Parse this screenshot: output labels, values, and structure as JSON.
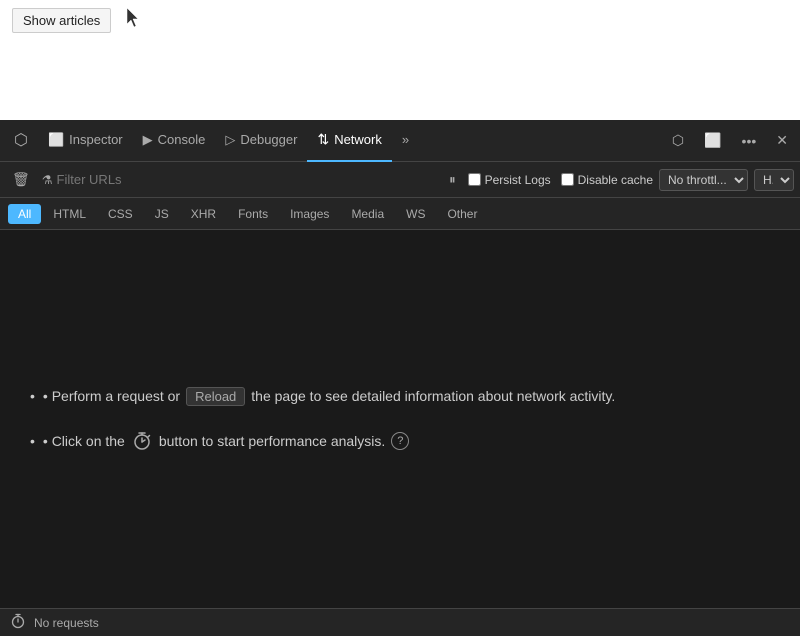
{
  "browser": {
    "show_articles_label": "Show articles"
  },
  "devtools": {
    "tabs": [
      {
        "id": "inspect",
        "label": "",
        "icon": "⬜",
        "active": false
      },
      {
        "id": "inspector",
        "label": "Inspector",
        "icon": "🔲",
        "active": false
      },
      {
        "id": "console",
        "label": "Console",
        "icon": "▶",
        "active": false
      },
      {
        "id": "debugger",
        "label": "Debugger",
        "icon": "▷",
        "active": false
      },
      {
        "id": "network",
        "label": "Network",
        "icon": "⇅",
        "active": true
      },
      {
        "id": "more",
        "label": "",
        "icon": "»",
        "active": false
      }
    ],
    "toolbar_right": {
      "screenshot_icon": "📷",
      "responsive_icon": "📱",
      "more_icon": "•••",
      "close_icon": "✕"
    },
    "filter": {
      "clear_label": "🗑",
      "placeholder": "Filter URLs",
      "pause_icon": "⏸",
      "persist_logs_label": "Persist Logs",
      "disable_cache_label": "Disable cache",
      "throttle_label": "No throttl...",
      "h_label": "H..."
    },
    "type_filters": [
      {
        "id": "all",
        "label": "All",
        "active": true
      },
      {
        "id": "html",
        "label": "HTML",
        "active": false
      },
      {
        "id": "css",
        "label": "CSS",
        "active": false
      },
      {
        "id": "js",
        "label": "JS",
        "active": false
      },
      {
        "id": "xhr",
        "label": "XHR",
        "active": false
      },
      {
        "id": "fonts",
        "label": "Fonts",
        "active": false
      },
      {
        "id": "images",
        "label": "Images",
        "active": false
      },
      {
        "id": "media",
        "label": "Media",
        "active": false
      },
      {
        "id": "ws",
        "label": "WS",
        "active": false
      },
      {
        "id": "other",
        "label": "Other",
        "active": false
      }
    ],
    "main": {
      "line1_prefix": "• Perform a request or",
      "line1_reload": "Reload",
      "line1_suffix": "the page to see detailed information about network activity.",
      "line2_prefix": "• Click on the",
      "line2_suffix": "button to start performance analysis.",
      "help_icon": "?"
    },
    "status": {
      "no_requests_label": "No requests"
    }
  }
}
